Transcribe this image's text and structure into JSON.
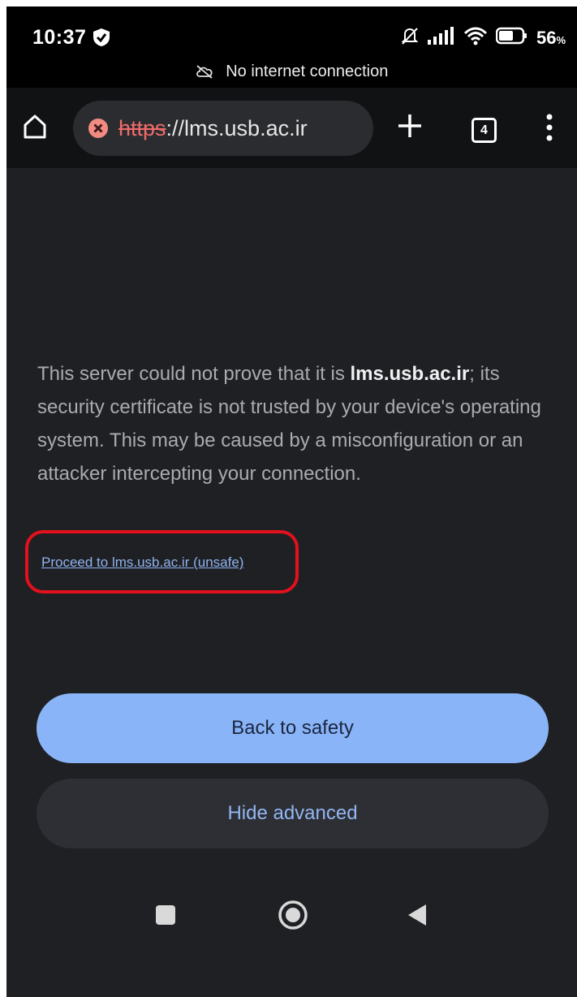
{
  "status_bar": {
    "time": "10:37",
    "battery": "56",
    "battery_unit": "%",
    "connection_notice": "No internet connection"
  },
  "browser": {
    "url_scheme": "https",
    "url_rest": "://lms.usb.ac.ir",
    "tab_count": "4",
    "icons": [
      "home-icon",
      "not-secure-icon",
      "new-tab-icon",
      "tab-switcher-icon",
      "more-menu-icon"
    ]
  },
  "interstitial": {
    "message_before": "This server could not prove that it is ",
    "message_domain": "lms.usb.ac.ir",
    "message_after": "; its security certificate is not trusted by your device's operating system. This may be caused by a misconfiguration or an attacker intercepting your connection.",
    "proceed_link": "Proceed to lms.usb.ac.ir (unsafe)",
    "back_button": "Back to safety",
    "hide_button": "Hide advanced"
  },
  "colors": {
    "page_background": "#1f2023",
    "primary_button": "#8ab4f8",
    "link": "#8fb3f0",
    "highlight_circle": "#e3101d",
    "url_scheme_danger": "#ef6a6a"
  },
  "nav_bar": {
    "icons": [
      "recents-icon",
      "home-circle-icon",
      "back-triangle-icon"
    ]
  }
}
